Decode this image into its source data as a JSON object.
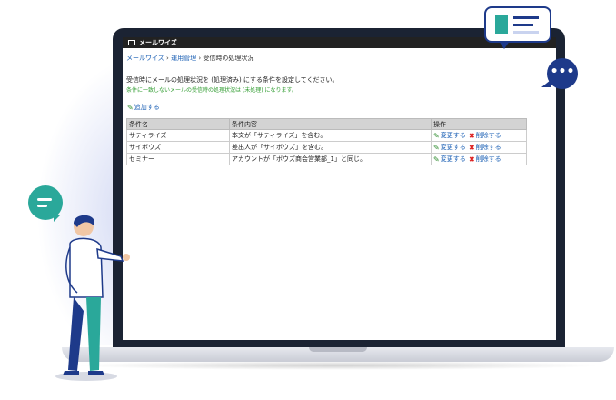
{
  "app": {
    "name": "メールワイズ"
  },
  "breadcrumb": {
    "home": "メールワイズ",
    "sep1": "›",
    "admin": "運用管理",
    "sep2": "›",
    "current": "受信時の処理状況"
  },
  "description": "受信時にメールの処理状況を (処理済み) にする条件を設定してください。",
  "note": "条件に一致しないメールの受信時の処理状況は (未処理) になります。",
  "add_label": "追加する",
  "table": {
    "headers": [
      "条件名",
      "条件内容",
      "操作"
    ],
    "rows": [
      {
        "name": "サティライズ",
        "condition": "本文が「サティライズ」を含む。",
        "edit": "変更する",
        "delete": "削除する"
      },
      {
        "name": "サイボウズ",
        "condition": "差出人が「サイボウズ」を含む。",
        "edit": "変更する",
        "delete": "削除する"
      },
      {
        "name": "セミナー",
        "condition": "アカウントが「ボウズ商会営業部_1」と同じ。",
        "edit": "変更する",
        "delete": "削除する"
      }
    ]
  },
  "colors": {
    "link": "#1a5fb4",
    "note": "#2e9b2e",
    "teal": "#2aa89a",
    "navy": "#1e3a8a",
    "delete": "#dd2222"
  },
  "icons": {
    "edit": "pencil-icon",
    "delete": "x-icon",
    "chat": "ellipsis-icon"
  }
}
